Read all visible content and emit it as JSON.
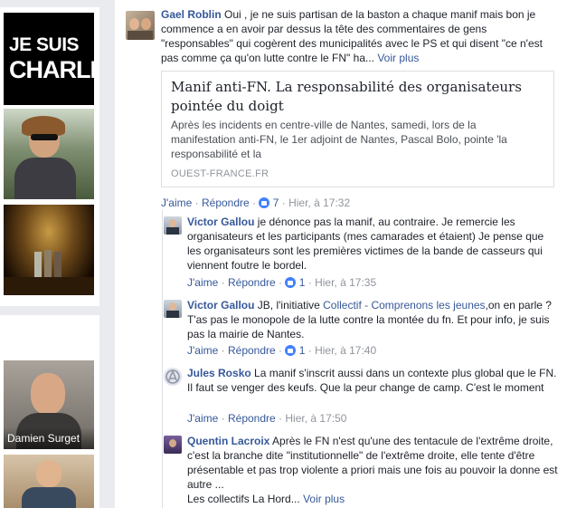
{
  "sidebar": {
    "charlie_line1": "JE SUIS",
    "charlie_line2": "CHARLIE",
    "person_name": "Damien Surget"
  },
  "post": {
    "author": "Gael Roblin",
    "text": " Oui , je ne suis partisan de la baston a chaque manif mais bon je commence a en avoir par dessus la tête des commentaires de gens \"responsables\" qui cogèrent des municipalités avec le PS et qui disent \"ce n'est pas comme ça qu'on lutte contre le FN\" ha... ",
    "see_more": "Voir plus",
    "card": {
      "title": "Manif anti-FN. La responsabilité des organisateurs pointée du doigt",
      "description": "Après les incidents en centre-ville de Nantes, samedi, lors de la manifestation anti-FN, le 1er adjoint de Nantes, Pascal Bolo, pointe 'la responsabilité et la",
      "source": "OUEST-FRANCE.FR"
    },
    "actions": {
      "like": "J'aime",
      "reply": "Répondre",
      "count": "7",
      "time": "Hier, à 17:32"
    }
  },
  "replies": [
    {
      "author": "Victor Gallou",
      "text": " je dénonce pas la manif, au contraire. Je remercie les organisateurs et les participants (mes camarades et étaient) Je pense que les organisateurs sont les premières victimes de la bande de casseurs qui viennent foutre le bordel.",
      "like": "J'aime",
      "reply": "Répondre",
      "count": "1",
      "time": "Hier, à 17:35"
    },
    {
      "author": "Victor Gallou",
      "text_before": " JB, l'initiative ",
      "mention": "Collectif - Comprenons les jeunes",
      "text_after": ",on en parle ? T'as pas le monopole de la lutte contre la montée du fn. Et pour info, je suis pas la mairie de Nantes.",
      "like": "J'aime",
      "reply": "Répondre",
      "count": "1",
      "time": "Hier, à 17:40"
    },
    {
      "author": "Jules Rosko",
      "text": " La manif s'inscrit aussi dans un contexte plus global que le FN. Il faut se venger des keufs. Que la peur change de camp. C'est le moment",
      "like": "J'aime",
      "reply": "Répondre",
      "time": "Hier, à 17:50"
    },
    {
      "author": "Quentin Lacroix",
      "text": " Après le FN n'est qu'une des tentacule de l'extrême droite, c'est la branche dite \"institutionnelle\" de l'extrême droite, elle tente d'être présentable et pas trop violente a priori mais une fois au pouvoir la donne est autre ...",
      "text2": "Les collectifs La Hord... ",
      "see_more": "Voir plus"
    }
  ],
  "separator": " · "
}
